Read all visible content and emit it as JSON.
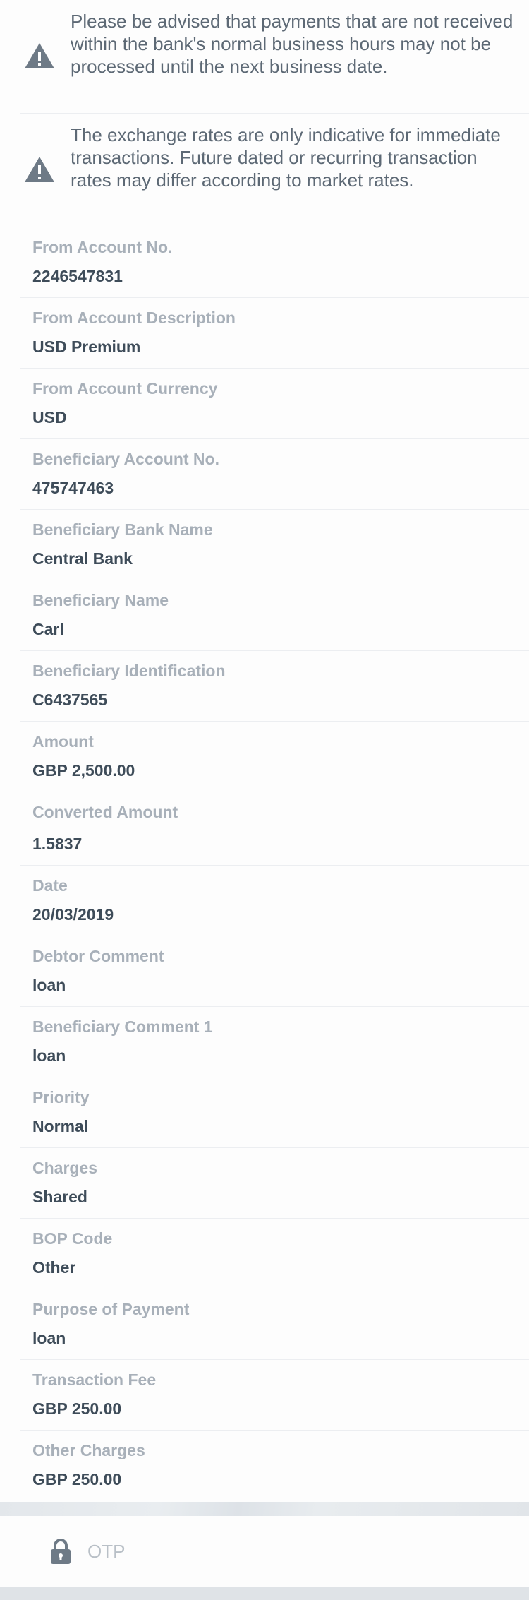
{
  "notices": [
    {
      "icon": "warning-icon",
      "text": "Please be advised that payments that are not received within the bank's normal business hours may not be processed until the next business date."
    },
    {
      "icon": "warning-icon",
      "text": "The exchange rates are only indicative for immediate transactions. Future dated or recurring transaction rates may differ according to market rates."
    }
  ],
  "fields": [
    {
      "label": "From Account No.",
      "value": "2246547831"
    },
    {
      "label": "From Account Description",
      "value": "USD Premium"
    },
    {
      "label": "From Account Currency",
      "value": "USD"
    },
    {
      "label": "Beneficiary Account No.",
      "value": "475747463"
    },
    {
      "label": "Beneficiary Bank Name",
      "value": "Central Bank"
    },
    {
      "label": "Beneficiary Name",
      "value": "Carl"
    },
    {
      "label": "Beneficiary Identification",
      "value": "C6437565"
    },
    {
      "label": "Amount",
      "value": "GBP 2,500.00"
    },
    {
      "label": "Converted Amount",
      "value": "1.5837"
    },
    {
      "label": "Date",
      "value": "20/03/2019"
    },
    {
      "label": "Debtor Comment",
      "value": "loan"
    },
    {
      "label": "Beneficiary Comment 1",
      "value": "loan"
    },
    {
      "label": "Priority",
      "value": "Normal"
    },
    {
      "label": "Charges",
      "value": "Shared"
    },
    {
      "label": "BOP Code",
      "value": "Other"
    },
    {
      "label": "Purpose of Payment",
      "value": "loan"
    },
    {
      "label": "Transaction Fee",
      "value": "GBP 250.00"
    },
    {
      "label": "Other Charges",
      "value": "GBP 250.00"
    }
  ],
  "otp": {
    "icon": "lock-icon",
    "placeholder": "OTP",
    "value": ""
  },
  "colors": {
    "label": "#a8b0b9",
    "value": "#3e4c59",
    "notice_text": "#5d6975",
    "icon": "#6e7a86"
  }
}
